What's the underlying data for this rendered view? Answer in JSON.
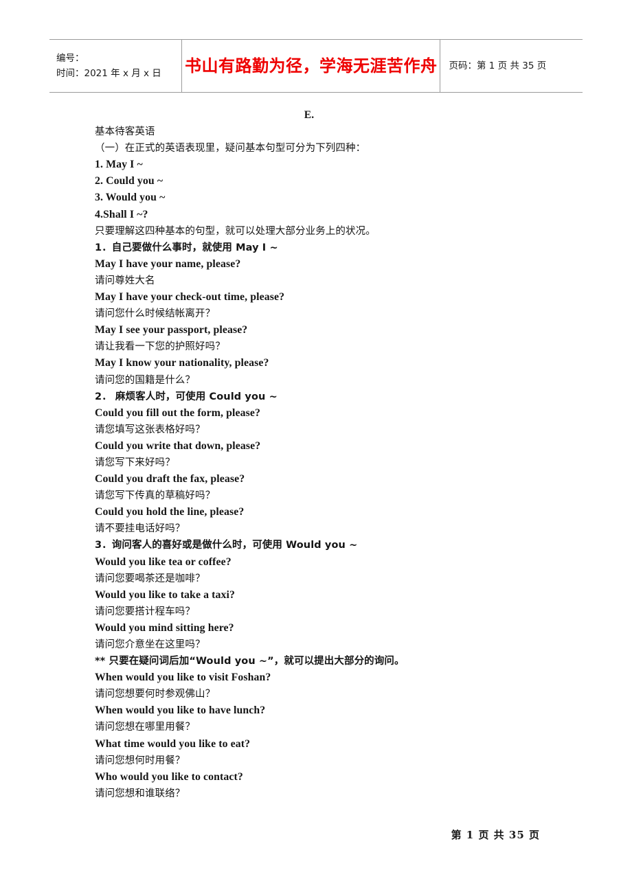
{
  "header": {
    "label_number": "编号：",
    "label_time": "时间：2021 年 x 月 x 日",
    "slogan": "书山有路勤为径，学海无涯苦作舟",
    "slogan_color": "#EE0000",
    "page_info": "页码：第 1 页  共 35 页"
  },
  "document": {
    "section_marker": "E.",
    "lines": [
      {
        "style": "cn",
        "text": "基本待客英语"
      },
      {
        "style": "cn",
        "text": "（一）在正式的英语表现里，疑问基本句型可分为下列四种："
      },
      {
        "style": "en",
        "text": "1. May I ~"
      },
      {
        "style": "en",
        "text": "2. Could you ~"
      },
      {
        "style": "en",
        "text": "3. Would you ~"
      },
      {
        "style": "en",
        "text": "4.Shall I ~?"
      },
      {
        "style": "cn",
        "text": "只要理解这四种基本的句型，就可以处理大部分业务上的状况。"
      },
      {
        "style": "mixed",
        "text": "1．自己要做什么事时，就使用 May I ~"
      },
      {
        "style": "en",
        "text": "May I have your name, please?"
      },
      {
        "style": "cn",
        "text": "请问尊姓大名"
      },
      {
        "style": "en",
        "text": "May I have your check-out time, please?"
      },
      {
        "style": "cn",
        "text": "请问您什么时候结帐离开？"
      },
      {
        "style": "en",
        "text": "May I see your passport, please?"
      },
      {
        "style": "cn",
        "text": "请让我看一下您的护照好吗？"
      },
      {
        "style": "en",
        "text": "May I know your nationality, please?"
      },
      {
        "style": "cn",
        "text": "请问您的国籍是什么？"
      },
      {
        "style": "mixed",
        "text": "2． 麻烦客人时，可使用 Could you ~"
      },
      {
        "style": "en",
        "text": "Could you fill out the form, please?"
      },
      {
        "style": "cn",
        "text": "请您填写这张表格好吗？"
      },
      {
        "style": "en",
        "text": "Could you write that down, please?"
      },
      {
        "style": "cn",
        "text": "请您写下来好吗？"
      },
      {
        "style": "en",
        "text": "Could you draft the fax, please?"
      },
      {
        "style": "cn",
        "text": "请您写下传真的草稿好吗？"
      },
      {
        "style": "en",
        "text": "Could you hold the line, please?"
      },
      {
        "style": "cn",
        "text": "请不要挂电话好吗？"
      },
      {
        "style": "mixed",
        "text": "3．询问客人的喜好或是做什么时，可使用 Would you ~"
      },
      {
        "style": "en",
        "text": "Would you like tea or coffee?"
      },
      {
        "style": "cn",
        "text": "请问您要喝茶还是咖啡？"
      },
      {
        "style": "en",
        "text": "Would you like to take a taxi?"
      },
      {
        "style": "cn",
        "text": "请问您要搭计程车吗？"
      },
      {
        "style": "en",
        "text": "Would you mind sitting here?"
      },
      {
        "style": "cn",
        "text": "请问您介意坐在这里吗？"
      },
      {
        "style": "mixed",
        "text": "** 只要在疑问词后加“Would you ~”，就可以提出大部分的询问。"
      },
      {
        "style": "en",
        "text": "When would you like to visit Foshan?"
      },
      {
        "style": "cn",
        "text": "请问您想要何时参观佛山？"
      },
      {
        "style": "en",
        "text": "When would you like to have lunch?"
      },
      {
        "style": "cn",
        "text": "请问您想在哪里用餐？"
      },
      {
        "style": "en",
        "text": "What time would you like to eat?"
      },
      {
        "style": "cn",
        "text": "请问您想何时用餐？"
      },
      {
        "style": "en",
        "text": "Who would you like to contact?"
      },
      {
        "style": "cn",
        "text": "请问您想和谁联络？"
      }
    ]
  },
  "footer": {
    "page_number_text": "第 1 页 共 35 页"
  }
}
